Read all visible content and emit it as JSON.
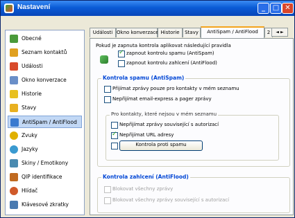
{
  "window": {
    "title": "Nastavení"
  },
  "sidebar": {
    "items": [
      {
        "label": "Obecné",
        "icon": "general-icon",
        "color": "#4a9a3a"
      },
      {
        "label": "Seznam kontaktů",
        "icon": "contacts-icon",
        "color": "#e0a020"
      },
      {
        "label": "Události",
        "icon": "events-icon",
        "color": "#d84a2a"
      },
      {
        "label": "Okno konverzace",
        "icon": "conversation-icon",
        "color": "#6a8fc8"
      },
      {
        "label": "Historie",
        "icon": "history-icon",
        "color": "#e8c020"
      },
      {
        "label": "Stavy",
        "icon": "status-icon",
        "color": "#e8b020"
      },
      {
        "label": "AntiSpam / AntiFlood",
        "icon": "antispam-icon",
        "color": "#3a7ad0"
      },
      {
        "label": "Zvuky",
        "icon": "sound-icon",
        "color": "#e0b000"
      },
      {
        "label": "Jazyky",
        "icon": "languages-icon",
        "color": "#3a9ad0"
      },
      {
        "label": "Skiny / Emotikony",
        "icon": "skins-icon",
        "color": "#4a8ab0"
      },
      {
        "label": "QIP identifikace",
        "icon": "qip-id-icon",
        "color": "#c06a20"
      },
      {
        "label": "Hlídač",
        "icon": "watcher-icon",
        "color": "#d05a2a"
      },
      {
        "label": "Klávesové zkratky",
        "icon": "keyboard-icon",
        "color": "#4a7ab0"
      }
    ],
    "active_index": 6
  },
  "tabs": [
    "Události",
    "Okno konverzace",
    "Historie",
    "Stavy",
    "AntiSpam / AntiFlood",
    "2"
  ],
  "tab_scroll": "◄ ►",
  "panel": {
    "intro": "Pokud je zapnuta kontrola aplikovat následující pravidla",
    "enable_antispam": {
      "label": "zapnout kontrolu spamu (AntiSpam)",
      "checked": true
    },
    "enable_antiflood": {
      "label": "zapnout kontrolu zahlcení (AntiFlood)",
      "checked": false
    },
    "spam_group": {
      "title": "Kontrola spamu (AntiSpam)",
      "only_contacts": {
        "label": "Přijímat zprávy pouze pro kontakty v mém seznamu",
        "checked": false
      },
      "no_email_express": {
        "label": "Nepřijímat email-express a pager zprávy",
        "checked": false
      },
      "sub_group": {
        "title": "Pro kontakty, které nejsou v mém seznamu",
        "no_auth_messages": {
          "label": "Nepřijímat zprávy související s autorizací",
          "checked": false
        },
        "no_urls": {
          "label": "Nepřijímat URL adresy",
          "checked": true
        },
        "spam_check_button": "Kontrola proti spamu"
      }
    },
    "flood_group": {
      "title": "Kontrola zahlcení (AntiFlood)",
      "block_all": {
        "label": "Blokovat všechny zprávy",
        "checked": false
      },
      "block_auth": {
        "label": "Blokovat všechny zprávy související s autorizací",
        "checked": false
      }
    }
  }
}
